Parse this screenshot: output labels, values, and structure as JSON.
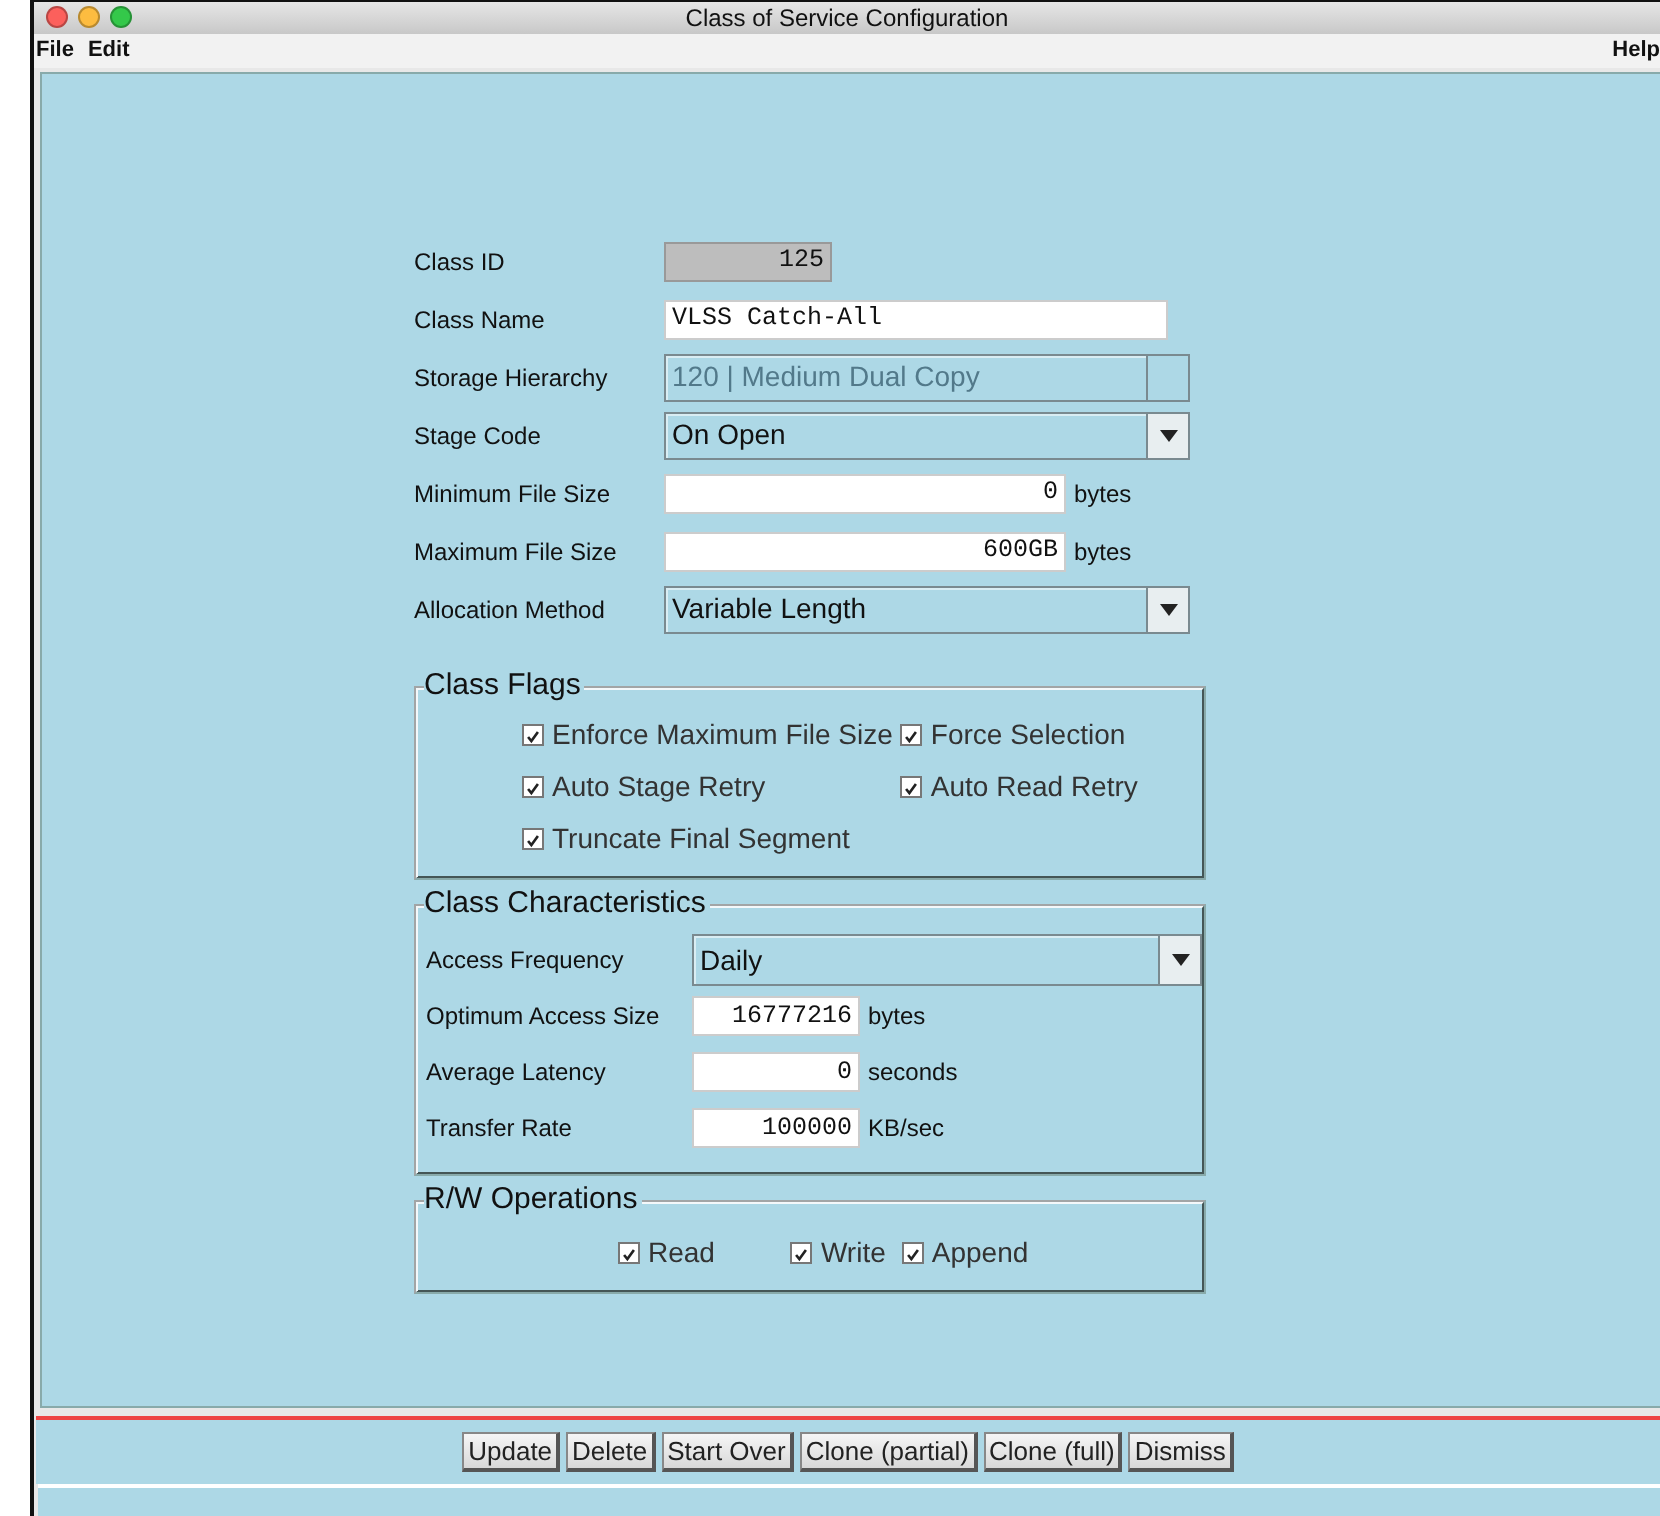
{
  "window": {
    "title": "Class of Service Configuration"
  },
  "menu": [
    "File",
    "Edit"
  ],
  "help_menu": "Help",
  "fields": [
    {
      "kind": "readonly",
      "label": "Class ID",
      "value": "125"
    },
    {
      "kind": "text",
      "label": "Class Name",
      "value": "VLSS Catch-All"
    },
    {
      "kind": "select",
      "label": "Storage Hierarchy",
      "value": "120 | Medium Dual Copy",
      "disabled": true
    },
    {
      "kind": "select",
      "label": "Stage Code",
      "value": "On Open",
      "disabled": false
    },
    {
      "kind": "number",
      "label": "Minimum File Size",
      "value": "0",
      "unit": "bytes"
    },
    {
      "kind": "number",
      "label": "Maximum File Size",
      "value": "600GB",
      "unit": "bytes"
    },
    {
      "kind": "select",
      "label": "Allocation Method",
      "value": "Variable Length",
      "disabled": false
    }
  ],
  "class_flags": {
    "title": "Class Flags",
    "items": [
      {
        "label": "Enforce Maximum File Size",
        "checked": true
      },
      {
        "label": "Force Selection",
        "checked": true
      },
      {
        "label": "Auto Stage Retry",
        "checked": true
      },
      {
        "label": "Auto Read Retry",
        "checked": true
      },
      {
        "label": "Truncate Final Segment",
        "checked": true
      }
    ]
  },
  "class_characteristics": {
    "title": "Class Characteristics",
    "fields": [
      {
        "kind": "select",
        "label": "Access Frequency",
        "value": "Daily"
      },
      {
        "kind": "number",
        "label": "Optimum Access Size",
        "value": "16777216",
        "unit": "bytes"
      },
      {
        "kind": "number",
        "label": "Average Latency",
        "value": "0",
        "unit": "seconds"
      },
      {
        "kind": "number",
        "label": "Transfer Rate",
        "value": "100000",
        "unit": "KB/sec"
      }
    ]
  },
  "rw_operations": {
    "title": "R/W Operations",
    "items": [
      {
        "label": "Read",
        "checked": true
      },
      {
        "label": "Write",
        "checked": true
      },
      {
        "label": "Append",
        "checked": true
      }
    ]
  },
  "buttons": [
    "Update",
    "Delete",
    "Start Over",
    "Clone (partial)",
    "Clone (full)",
    "Dismiss"
  ]
}
